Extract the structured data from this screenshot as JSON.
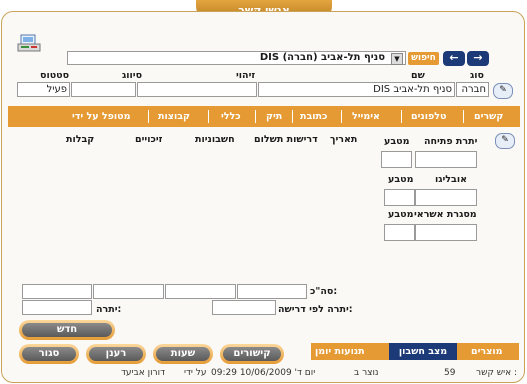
{
  "window": {
    "title": "אנשי קשר"
  },
  "search": {
    "button": "חיפוש",
    "value": "DIS סניף תל-אביב (חברה)"
  },
  "fields": {
    "type_label": "סוג",
    "type_value": "חברה",
    "name_label": "שם",
    "name_value": "DIS סניף תל-אביב",
    "id_label": "זיהוי",
    "class_label": "סיווג",
    "status_label": "סטטוס",
    "status_value": "פעיל"
  },
  "menu": [
    "קשרים",
    "טלפונים",
    "אימייל",
    "כתובת",
    "תיק",
    "כללי",
    "קבוצות",
    "מטופל על ידי"
  ],
  "account": {
    "headers": [
      "יתרת פתיחה",
      "מטבע",
      "תאריך",
      "דרישות תשלום",
      "חשבוניות",
      "זיכויים",
      "קבלות"
    ],
    "obligo_label": "אובליגו",
    "obligo_currency": "מטבע",
    "credit_label": "מסגרת אשראי",
    "credit_currency": "מטבע",
    "total_label": "סה\"כ:",
    "balance_req_label": "יתרה לפי דרישה:",
    "balance_label": "יתרה:"
  },
  "buttons": {
    "new": "חדש",
    "links": "קישורים",
    "hours": "שעות",
    "refresh": "רענן",
    "close": "סגור"
  },
  "tabs": [
    "מוצרים",
    "מצב חשבון",
    "תנועות יומן"
  ],
  "footer": {
    "contact_no_label": "איש קשר :",
    "contact_no": "59",
    "created_label": "נוצר ב",
    "created_value": "יום ד' 10/06/2009 09:29",
    "by_label": "על ידי",
    "by_value": "דורון אביעד"
  }
}
